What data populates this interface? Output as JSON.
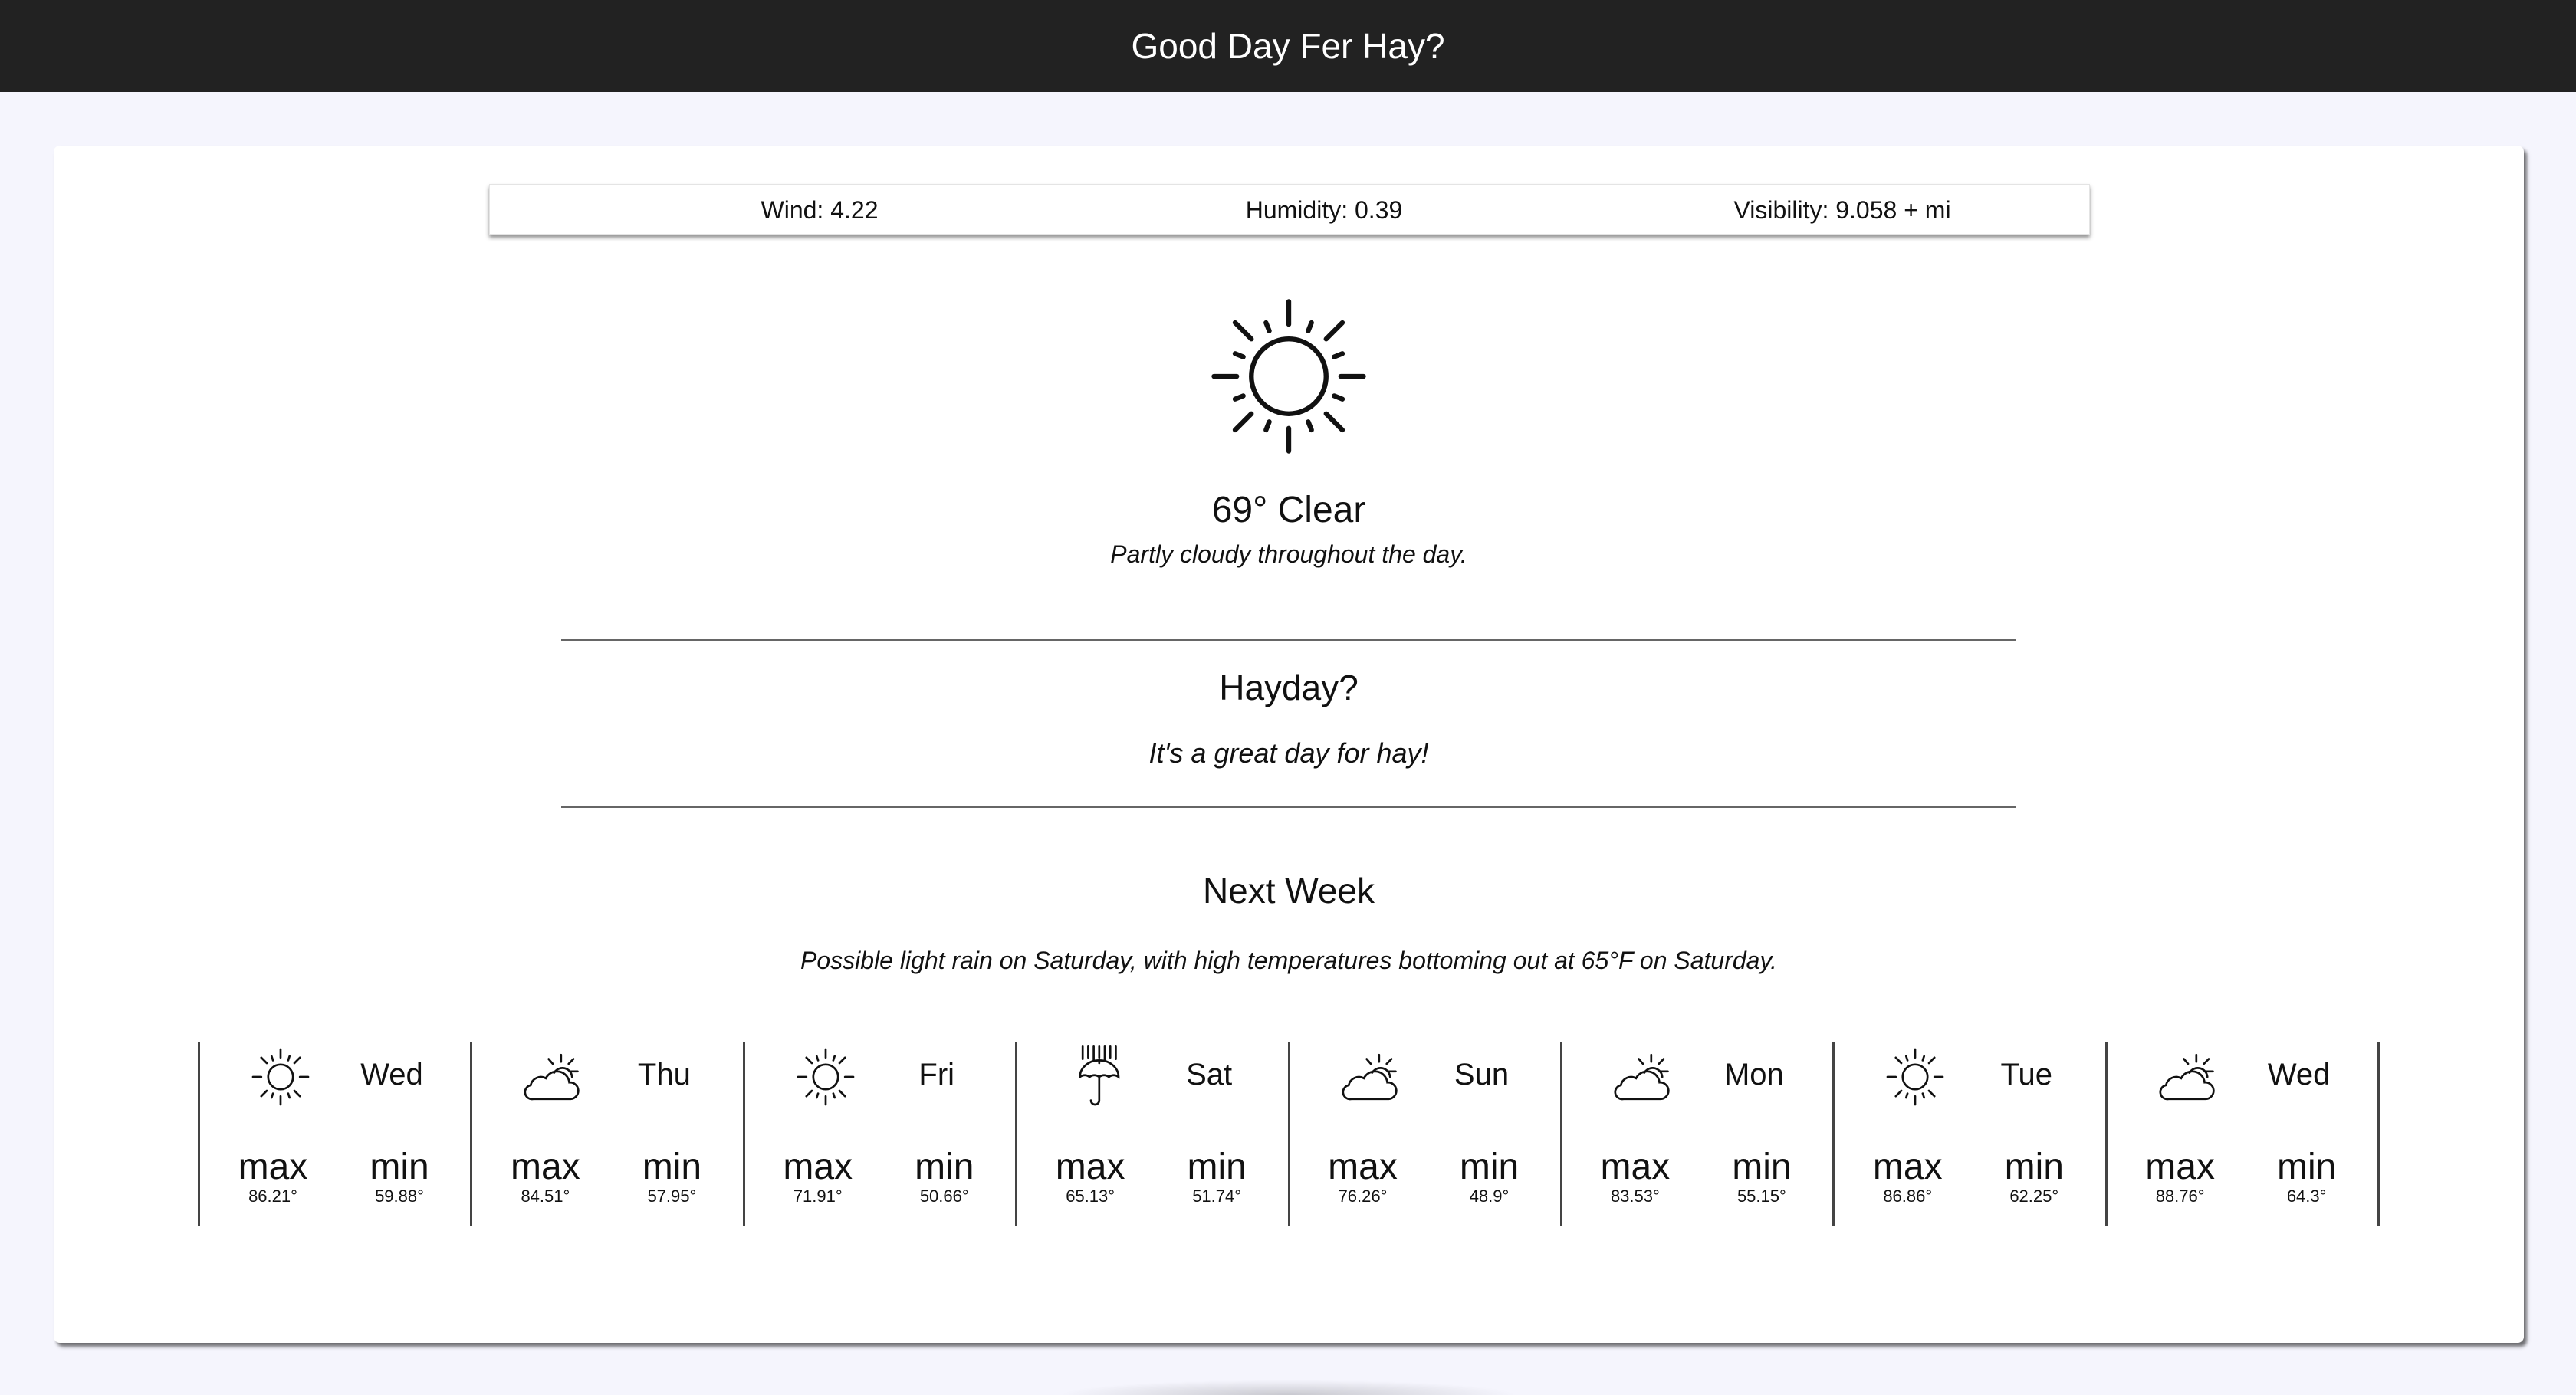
{
  "app": {
    "title": "Good Day Fer Hay?"
  },
  "stats": {
    "wind_label": "Wind:",
    "wind_value": "4.22",
    "humidity_label": "Humidity:",
    "humidity_value": "0.39",
    "visibility_label": "Visibility:",
    "visibility_value": "9.058 + mi"
  },
  "current": {
    "icon": "sun-icon",
    "temp_condition": "69° Clear",
    "summary": "Partly cloudy throughout the day."
  },
  "hayday": {
    "heading": "Hayday?",
    "answer": "It's a great day for hay!"
  },
  "week": {
    "heading": "Next Week",
    "summary": "Possible light rain on Saturday, with high temperatures bottoming out at 65°F on Saturday.",
    "max_label": "max",
    "min_label": "min",
    "days": [
      {
        "name": "Wed",
        "icon": "clear-day",
        "max": "86.21°",
        "min": "59.88°"
      },
      {
        "name": "Thu",
        "icon": "partly-cloudy-day",
        "max": "84.51°",
        "min": "57.95°"
      },
      {
        "name": "Fri",
        "icon": "clear-day",
        "max": "71.91°",
        "min": "50.66°"
      },
      {
        "name": "Sat",
        "icon": "rain",
        "max": "65.13°",
        "min": "51.74°"
      },
      {
        "name": "Sun",
        "icon": "partly-cloudy-day",
        "max": "76.26°",
        "min": "48.9°"
      },
      {
        "name": "Mon",
        "icon": "partly-cloudy-day",
        "max": "83.53°",
        "min": "55.15°"
      },
      {
        "name": "Tue",
        "icon": "clear-day",
        "max": "86.86°",
        "min": "62.25°"
      },
      {
        "name": "Wed",
        "icon": "partly-cloudy-day",
        "max": "88.76°",
        "min": "64.3°"
      }
    ]
  }
}
